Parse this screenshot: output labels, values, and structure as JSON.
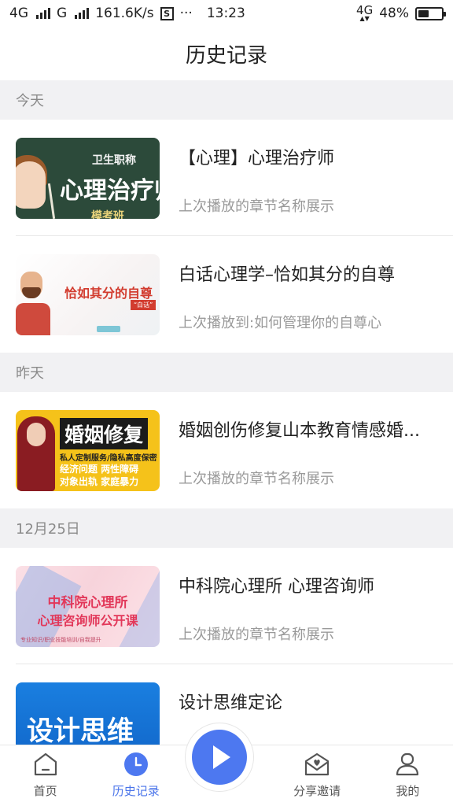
{
  "status_bar": {
    "network1": "4G",
    "network2": "G",
    "speed": "161.6K/s",
    "s_badge": "S",
    "dots": "···",
    "time": "13:23",
    "net_type": "4G",
    "battery_percent": "48%",
    "battery_level": 0.48
  },
  "header": {
    "title": "历史记录"
  },
  "sections": [
    {
      "label": "今天",
      "items": [
        {
          "title": "【心理】心理治疗师",
          "subtitle": "上次播放的章节名称展示",
          "thumb": {
            "small": "卫生职称",
            "big": "心理治疗师",
            "sub": "模考班"
          }
        },
        {
          "title": "白话心理学–恰如其分的自尊",
          "subtitle": "上次播放到:如何管理你的自尊心",
          "thumb": {
            "text": "恰如其分的自尊",
            "tag": "“白话”"
          }
        }
      ]
    },
    {
      "label": "昨天",
      "items": [
        {
          "title": "婚姻创伤修复山本教育情感婚...",
          "subtitle": "上次播放的章节名称展示",
          "thumb": {
            "big": "婚姻修复",
            "line1": "私人定制服务/隐私高度保密",
            "line2": "经济问题 两性障碍",
            "line3": "对象出轨 家庭暴力"
          }
        }
      ]
    },
    {
      "label": "12月25日",
      "items": [
        {
          "title": "中科院心理所 心理咨询师",
          "subtitle": "上次播放的章节名称展示",
          "thumb": {
            "line1": "中科院心理所",
            "line2": "心理咨询师公开课",
            "line3": "专业知识/职业技能培训/自我提升"
          }
        },
        {
          "title": "设计思维定论",
          "subtitle": "",
          "thumb": {
            "big": "设计思维"
          }
        }
      ]
    }
  ],
  "bottom_nav": {
    "home": "首页",
    "history": "历史记录",
    "share": "分享邀请",
    "mine": "我的",
    "active": "history"
  },
  "colors": {
    "accent": "#4d78f0",
    "section_bg": "#f1f1f3"
  },
  "icons": [
    "home-icon",
    "clock-icon",
    "play-icon",
    "mail-heart-icon",
    "person-icon"
  ]
}
